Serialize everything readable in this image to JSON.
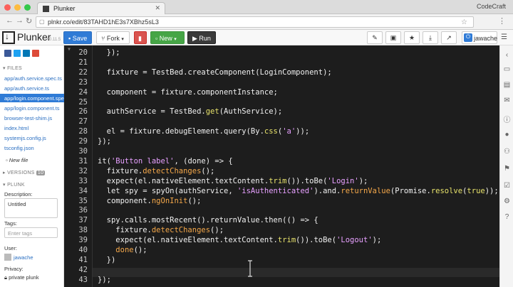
{
  "browser": {
    "tab_title": "Plunker",
    "corner_label": "CodeCraft",
    "url": "plnkr.co/edit/83TAHD1hE3s7XBhz5sL3"
  },
  "toolbar": {
    "logo": "Plunker",
    "version": "v0.11.5",
    "save_label": "Save",
    "fork_label": "Fork",
    "new_label": "New",
    "run_label": "Run",
    "user_label": "jawache"
  },
  "sidebar": {
    "files_header": "FILES",
    "files": [
      "app/auth.service.spec.ts",
      "app/auth.service.ts",
      "app/login.component.spec",
      "app/login.component.ts",
      "browser-test-shim.js",
      "index.html",
      "systemjs.config.js",
      "tsconfig.json"
    ],
    "active_index": 2,
    "new_file": "New file",
    "versions_header": "VERSIONS",
    "versions_count": "10",
    "plunk_header": "PLUNK",
    "description_label": "Description:",
    "description_value": "Untitled",
    "tags_label": "Tags:",
    "tags_placeholder": "Enter tags",
    "user_label": "User:",
    "user_name": "jawache",
    "privacy_label": "Privacy:",
    "privacy_value": "private plunk"
  },
  "editor": {
    "line_numbers": [
      "20",
      "21",
      "22",
      "23",
      "24",
      "25",
      "26",
      "27",
      "28",
      "29",
      "30",
      "31",
      "32",
      "33",
      "34",
      "35",
      "36",
      "37",
      "38",
      "39",
      "40",
      "41",
      "42",
      "43"
    ],
    "lines": [
      "  });",
      "",
      "  fixture = TestBed.createComponent(LoginComponent);",
      "",
      "  component = fixture.componentInstance;",
      "",
      "  authService = TestBed.get(AuthService);",
      "",
      "  el = fixture.debugElement.query(By.css('a'));",
      "});",
      "",
      "it('Button label', (done) => {",
      "  fixture.detectChanges();",
      "  expect(el.nativeElement.textContent.trim()).toBe('Login');",
      "  let spy = spyOn(authService, 'isAuthenticated').and.returnValue(Promise.resolve(true));",
      "  component.ngOnInit();",
      "",
      "  spy.calls.mostRecent().returnValue.then(() => {",
      "    fixture.detectChanges();",
      "    expect(el.nativeElement.textContent.trim()).toBe('Logout');",
      "    done();",
      "  })",
      "",
      "});"
    ]
  }
}
